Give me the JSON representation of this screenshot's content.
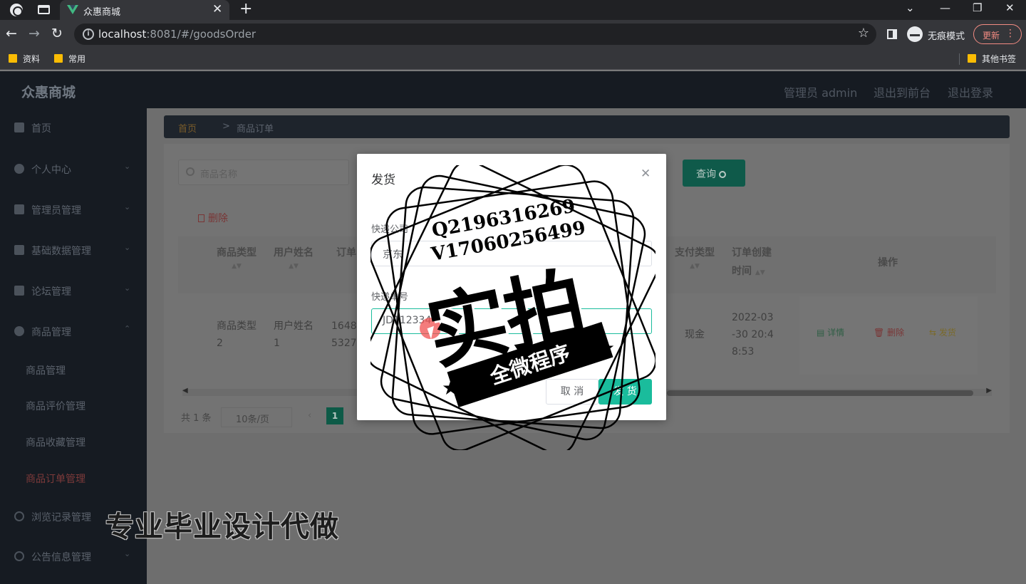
{
  "browser": {
    "tab_title": "众惠商城",
    "url_host": "localhost",
    "url_rest": ":8081/#/goodsOrder",
    "incognito_label": "无痕模式",
    "update_label": "更新",
    "bookmarks": [
      "资料",
      "常用"
    ],
    "other_bookmarks": "其他书签"
  },
  "header": {
    "brand": "众惠商城",
    "user": "管理员 admin",
    "back_to_front": "退出到前台",
    "logout": "退出登录"
  },
  "sidebar": {
    "items": [
      {
        "label": "首页"
      },
      {
        "label": "个人中心"
      },
      {
        "label": "管理员管理"
      },
      {
        "label": "基础数据管理"
      },
      {
        "label": "论坛管理"
      },
      {
        "label": "商品管理"
      }
    ],
    "sub_items": [
      "商品管理",
      "商品评价管理",
      "商品收藏管理",
      "商品订单管理"
    ],
    "items_after": [
      {
        "label": "浏览记录管理"
      },
      {
        "label": "公告信息管理"
      }
    ]
  },
  "breadcrumb": {
    "home": "首页",
    "separator": ">",
    "current": "商品订单"
  },
  "toolbar": {
    "search_placeholder": "商品名称",
    "query_label": "查询",
    "delete_label": "删除"
  },
  "table": {
    "headers": [
      "商品类型",
      "用户姓名",
      "订单",
      "支付类型",
      "订单创建时间",
      "操作"
    ],
    "row": {
      "goods_type": "商品类型2",
      "user_name": "用户姓名1",
      "order_no": "16486 5327",
      "pay_type": "现金",
      "created": "2022-03-30 20:48:53"
    },
    "ops": [
      "详情",
      "删除",
      "发货"
    ]
  },
  "pagination": {
    "total": "共 1 条",
    "page_size": "10条/页",
    "current_page": "1"
  },
  "dialog": {
    "title": "发货",
    "company_label": "快递公司",
    "company_value": "京东",
    "tracking_label": "快递单号",
    "tracking_value": "JD112334",
    "cancel_label": "取 消",
    "confirm_label": "发 货"
  },
  "watermark": {
    "qq": "Q2196316269",
    "wechat": "V17060256499",
    "big": "实拍",
    "ribbon": "全微程序",
    "caption": "专业毕业设计代做"
  },
  "colors": {
    "primary": "#1abc9c",
    "header_bg": "#161b22"
  }
}
